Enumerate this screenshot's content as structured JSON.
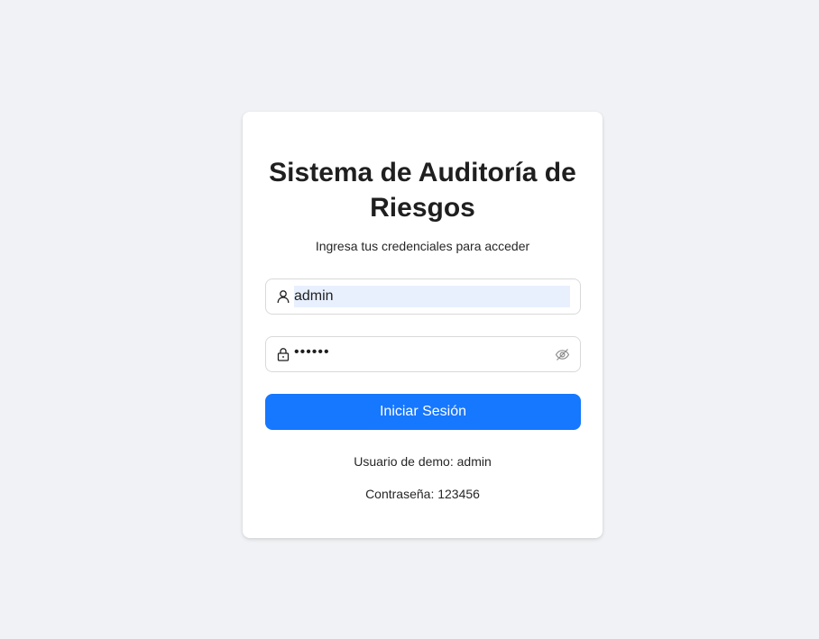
{
  "login": {
    "title": "Sistema de Auditoría de Riesgos",
    "subtitle": "Ingresa tus credenciales para acceder",
    "username": {
      "value": "admin",
      "icon": "user-icon"
    },
    "password": {
      "masked_value": "••••••",
      "icon": "lock-icon",
      "toggle_icon": "eye-invisible-icon"
    },
    "submit_label": "Iniciar Sesión",
    "demo_user_text": "Usuario de demo: admin",
    "demo_password_text": "Contraseña: 123456"
  },
  "colors": {
    "background": "#f0f2f5",
    "primary": "#1677ff",
    "autofill": "#e8f0fe"
  }
}
